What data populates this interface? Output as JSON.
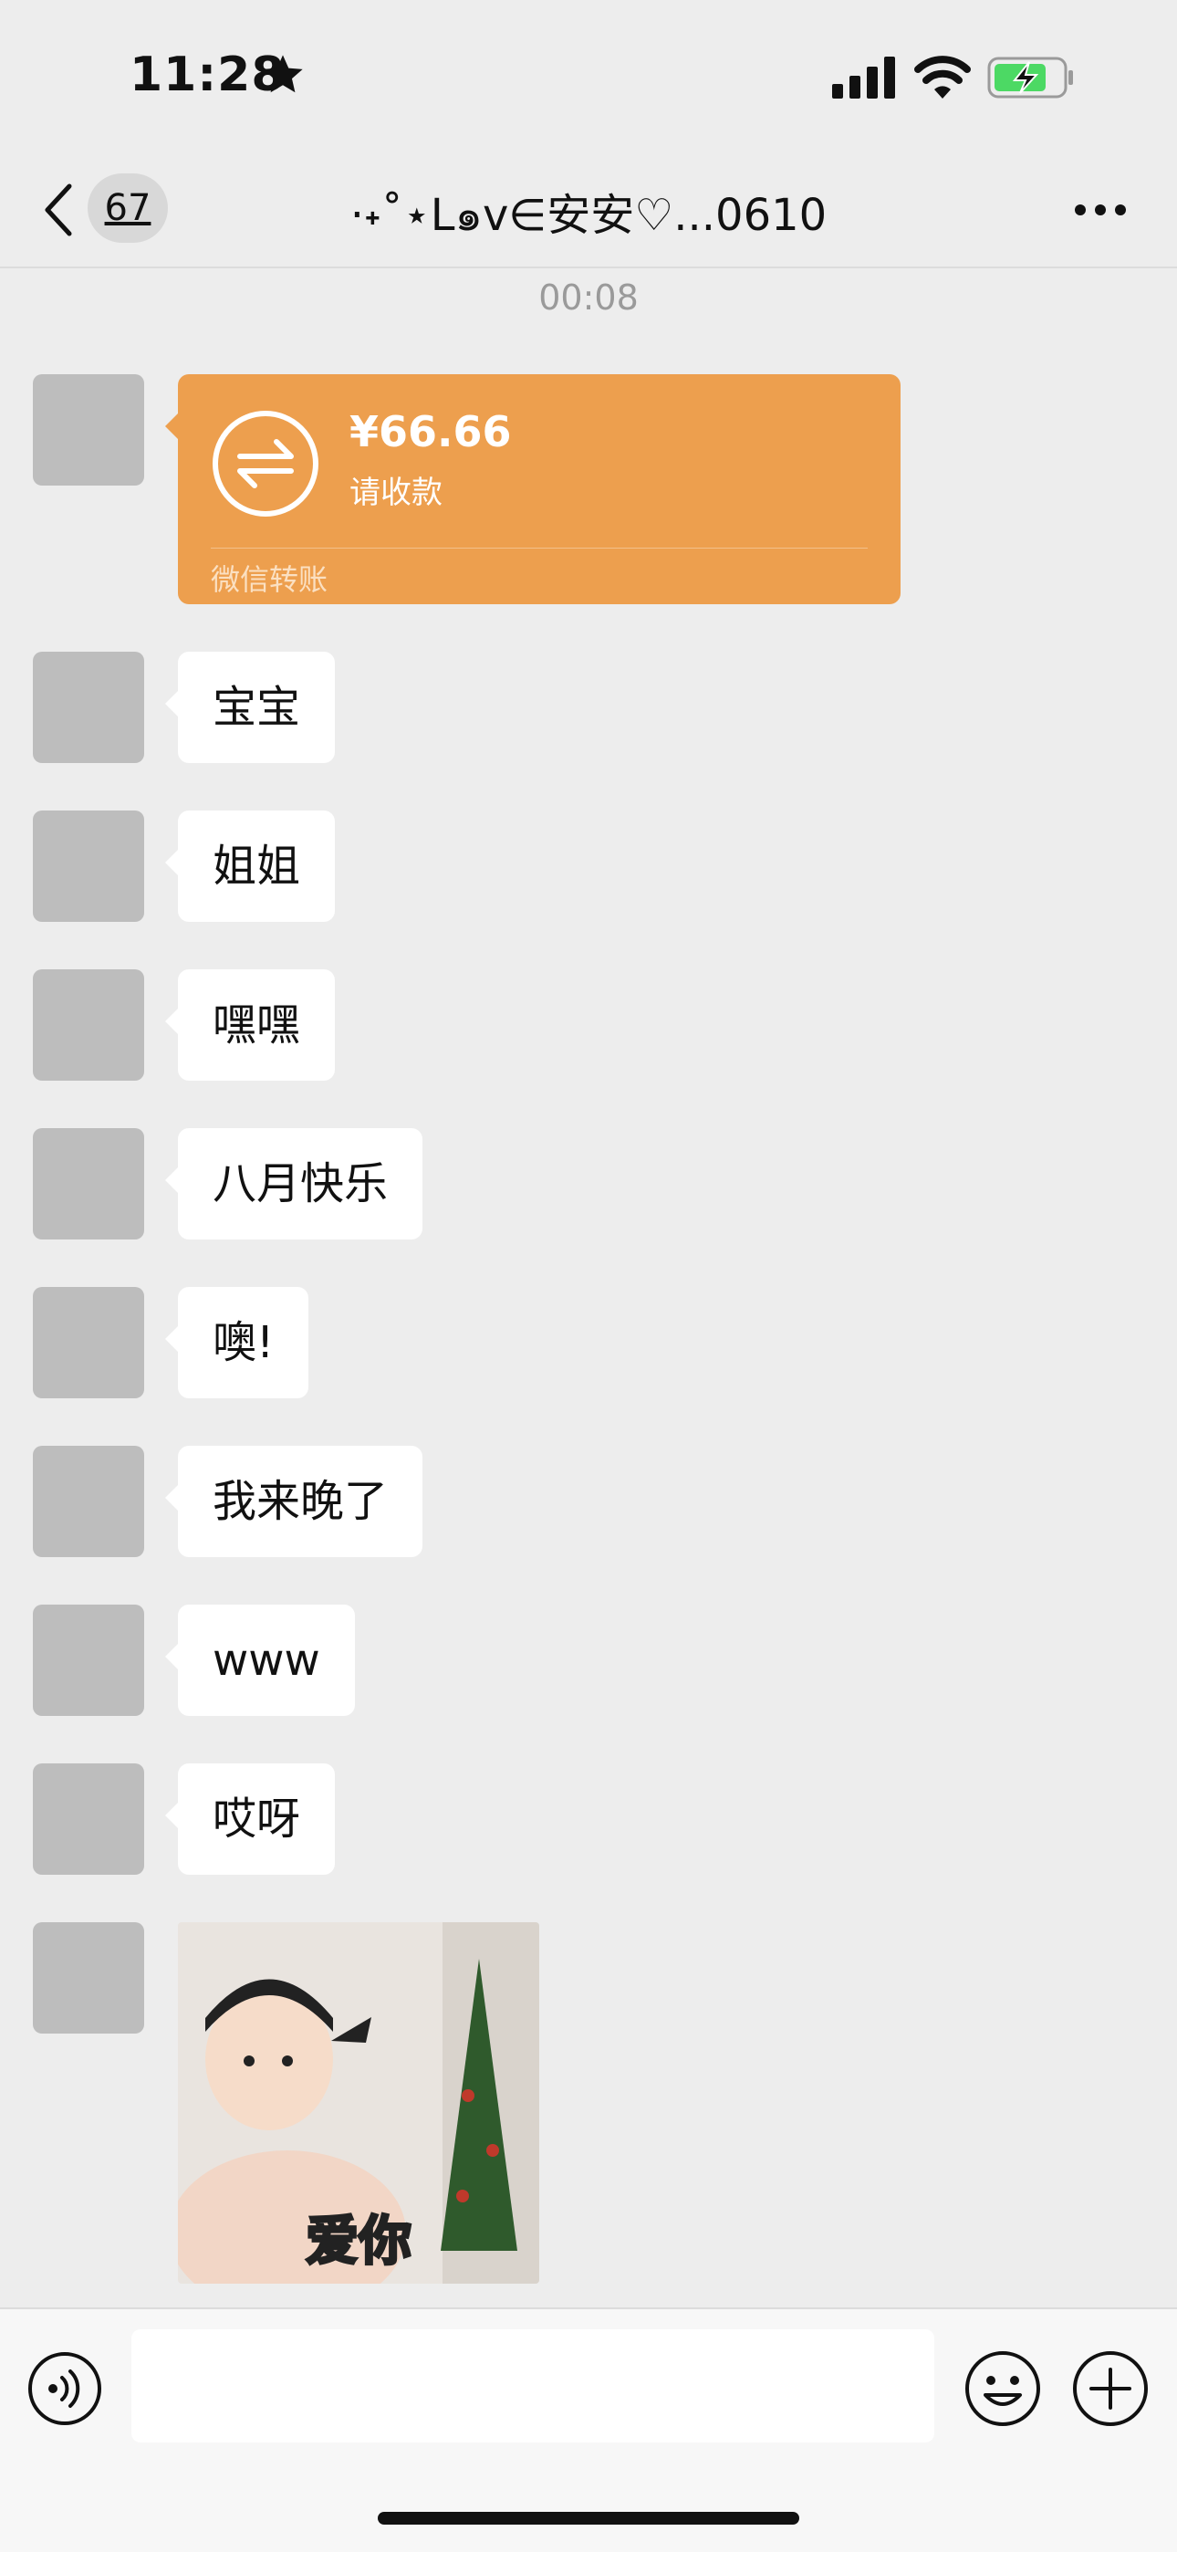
{
  "status_bar": {
    "time": "11:28",
    "icons": [
      "star-icon",
      "cellular-signal-icon",
      "wifi-icon",
      "battery-charging-icon"
    ]
  },
  "nav": {
    "unread_count": "67",
    "title": "·˖˚⋆L๑v∈安安♡...0610",
    "icons": [
      "chevron-left-icon",
      "more-horizontal-icon"
    ]
  },
  "chat": {
    "timestamp": "00:08",
    "transfer": {
      "amount": "¥66.66",
      "subtitle": "请收款",
      "label": "微信转账"
    },
    "messages": [
      "宝宝",
      "姐姐",
      "嘿嘿",
      "八月快乐",
      "噢!",
      "我来晚了",
      "www",
      "哎呀"
    ],
    "sticker": {
      "caption": "爱你"
    }
  },
  "input_bar": {
    "icons": [
      "voice-icon",
      "emoji-icon",
      "plus-circle-icon"
    ],
    "value": ""
  },
  "colors": {
    "background": "#ededed",
    "bubble": "#ffffff",
    "transfer": "#ed9f4e",
    "battery_charge": "#4cd964"
  }
}
